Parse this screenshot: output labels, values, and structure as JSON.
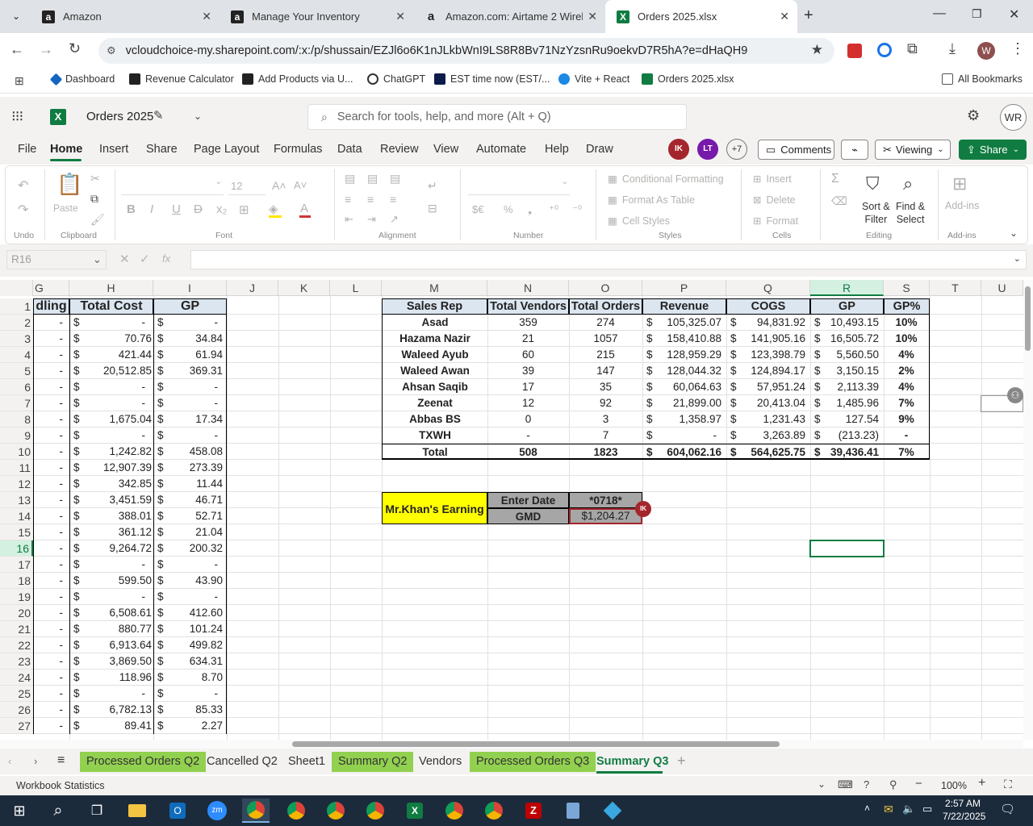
{
  "browser": {
    "tabs": [
      {
        "title": "Amazon"
      },
      {
        "title": "Manage Your Inventory"
      },
      {
        "title": "Amazon.com: Airtame 2 Wirele..."
      },
      {
        "title": "Orders 2025.xlsx"
      }
    ],
    "url": "vcloudchoice-my.sharepoint.com/:x:/p/shussain/EZJl6o6K1nJLkbWnI9LS8R8Bv71NzYzsnRu9oekvD7R5hA?e=dHaQH9",
    "profile_initial": "W",
    "bookmarks": [
      "Dashboard",
      "Revenue Calculator",
      "Add Products via U...",
      "ChatGPT",
      "EST time now (EST/...",
      "Vite + React",
      "Orders 2025.xlsx"
    ],
    "all_bookmarks": "All Bookmarks"
  },
  "excel": {
    "title": "Orders 2025",
    "search_placeholder": "Search for tools, help, and more (Alt + Q)",
    "user_initials": "WR",
    "menu": [
      "File",
      "Home",
      "Insert",
      "Share",
      "Page Layout",
      "Formulas",
      "Data",
      "Review",
      "View",
      "Automate",
      "Help",
      "Draw"
    ],
    "presence": [
      "IK",
      "LT"
    ],
    "presence_more": "+7",
    "comments_label": "Comments",
    "viewing_label": "Viewing",
    "share_label": "Share",
    "ribbon": {
      "undo_group": "Undo",
      "paste": "Paste",
      "clipboard_group": "Clipboard",
      "font_size": "12",
      "font_group": "Font",
      "alignment_group": "Alignment",
      "number_group": "Number",
      "conditional_formatting": "Conditional Formatting",
      "format_as_table": "Format As Table",
      "cell_styles": "Cell Styles",
      "styles_group": "Styles",
      "insert": "Insert",
      "delete": "Delete",
      "format": "Format",
      "cells_group": "Cells",
      "sort_filter_1": "Sort &",
      "sort_filter_2": "Filter",
      "find_select_1": "Find &",
      "find_select_2": "Select",
      "editing_group": "Editing",
      "addins": "Add-ins",
      "addins_group": "Add-ins"
    },
    "name_box": "R16",
    "columns": [
      "G",
      "H",
      "I",
      "J",
      "K",
      "L",
      "M",
      "N",
      "O",
      "P",
      "Q",
      "R",
      "S",
      "T",
      "U"
    ],
    "rows": [
      "1",
      "2",
      "3",
      "4",
      "5",
      "6",
      "7",
      "8",
      "9",
      "10",
      "11",
      "12",
      "13",
      "14",
      "15",
      "16",
      "17",
      "18",
      "19",
      "20",
      "21",
      "22",
      "23",
      "24",
      "25",
      "26",
      "27"
    ],
    "left_table": {
      "headers": [
        "dling",
        "Total Cost",
        "GP"
      ],
      "rows": [
        [
          "-",
          "-",
          "-"
        ],
        [
          "-",
          "70.76",
          "34.84"
        ],
        [
          "-",
          "421.44",
          "61.94"
        ],
        [
          "-",
          "20,512.85",
          "369.31"
        ],
        [
          "-",
          "-",
          "-"
        ],
        [
          "-",
          "-",
          "-"
        ],
        [
          "-",
          "1,675.04",
          "17.34"
        ],
        [
          "-",
          "-",
          "-"
        ],
        [
          "-",
          "1,242.82",
          "458.08"
        ],
        [
          "-",
          "12,907.39",
          "273.39"
        ],
        [
          "-",
          "342.85",
          "11.44"
        ],
        [
          "-",
          "3,451.59",
          "46.71"
        ],
        [
          "-",
          "388.01",
          "52.71"
        ],
        [
          "-",
          "361.12",
          "21.04"
        ],
        [
          "-",
          "9,264.72",
          "200.32"
        ],
        [
          "-",
          "-",
          "-"
        ],
        [
          "-",
          "599.50",
          "43.90"
        ],
        [
          "-",
          "-",
          "-"
        ],
        [
          "-",
          "6,508.61",
          "412.60"
        ],
        [
          "-",
          "880.77",
          "101.24"
        ],
        [
          "-",
          "6,913.64",
          "499.82"
        ],
        [
          "-",
          "3,869.50",
          "634.31"
        ],
        [
          "-",
          "118.96",
          "8.70"
        ],
        [
          "-",
          "-",
          "-"
        ],
        [
          "-",
          "6,782.13",
          "85.33"
        ],
        [
          "-",
          "89.41",
          "2.27"
        ]
      ]
    },
    "summary_table": {
      "headers": [
        "Sales Rep",
        "Total Vendors",
        "Total Orders",
        "Revenue",
        "COGS",
        "GP",
        "GP%"
      ],
      "rows": [
        [
          "Asad",
          "359",
          "274",
          "105,325.07",
          "94,831.92",
          "10,493.15",
          "10%"
        ],
        [
          "Hazama Nazir",
          "21",
          "1057",
          "158,410.88",
          "141,905.16",
          "16,505.72",
          "10%"
        ],
        [
          "Waleed Ayub",
          "60",
          "215",
          "128,959.29",
          "123,398.79",
          "5,560.50",
          "4%"
        ],
        [
          "Waleed Awan",
          "39",
          "147",
          "128,044.32",
          "124,894.17",
          "3,150.15",
          "2%"
        ],
        [
          "Ahsan Saqib",
          "17",
          "35",
          "60,064.63",
          "57,951.24",
          "2,113.39",
          "4%"
        ],
        [
          "Zeenat",
          "12",
          "92",
          "21,899.00",
          "20,413.04",
          "1,485.96",
          "7%"
        ],
        [
          "Abbas BS",
          "0",
          "3",
          "1,358.97",
          "1,231.43",
          "127.54",
          "9%"
        ],
        [
          "TXWH",
          "-",
          "7",
          "-",
          "3,263.89",
          "(213.23)",
          "-"
        ]
      ],
      "total": [
        "Total",
        "508",
        "1823",
        "604,062.16",
        "564,625.75",
        "39,436.41",
        "7%"
      ]
    },
    "earning": {
      "label": "Mr.Khan's Earning",
      "enter_date_label": "Enter Date",
      "enter_date_value": "*0718*",
      "gmd_label": "GMD",
      "gmd_value": "$1,204.27",
      "presence_tag": "IK"
    },
    "sheets": [
      "Processed Orders Q2",
      "Cancelled Q2",
      "Sheet1",
      "Summary Q2",
      "Vendors",
      "Processed Orders Q3",
      "Summary Q3"
    ],
    "active_sheet": "Summary Q3",
    "status_left": "Workbook Statistics",
    "zoom": "100%"
  },
  "taskbar": {
    "time": "2:57 AM",
    "date": "7/22/2025"
  },
  "colors": {
    "excel_green": "#107c41",
    "tab_green": "#92d050",
    "header_fill": "#dce6f1",
    "yellow": "#ffff00",
    "grey_fill": "#a6a6a6",
    "taskbar": "#1c2b3c"
  }
}
